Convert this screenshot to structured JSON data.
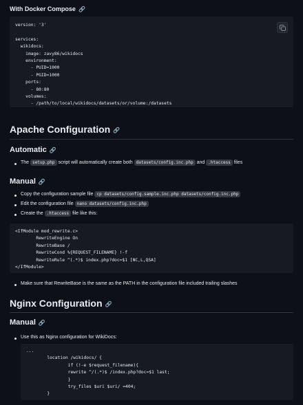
{
  "compose": {
    "heading": "With Docker Compose",
    "code": "version: '3'\n\nservices:\n  wikidocs:\n    image: zavy86/wikidocs\n    environment:\n      - PUID=1000\n      - PGID=1000\n    ports:\n      - 80:80\n    volumes:\n      - /path/to/local/wikidocs/datasets/or/volume:/datasets"
  },
  "apache": {
    "heading": "Apache Configuration",
    "automatic": {
      "heading": "Automatic",
      "line": {
        "t1": "The",
        "c1": "setup.php",
        "t2": "script will automatically create both",
        "c2": "datasets/config.inc.php",
        "t3": "and",
        "c3": ".htaccess",
        "t4": "files"
      }
    },
    "manual": {
      "heading": "Manual",
      "step1": {
        "t1": "Copy the configuration sample file",
        "c1": "cp datasets/config.sample.inc.php datasets/config.inc.php"
      },
      "step2": {
        "t1": "Edit the configuration file",
        "c1": "nano datasets/config.inc.php"
      },
      "step3": {
        "t1": "Create the",
        "c1": ".htaccess",
        "t2": "file like this:"
      },
      "code": "<IfModule mod_rewrite.c>\n        RewriteEngine On\n        RewriteBase /\n        RewriteCond %{REQUEST_FILENAME} !-f\n        RewriteRule ^(.*)$ index.php?doc=$1 [NC,L,QSA]\n</IfModule>",
      "note": "Make sure that RewriteBase is the same as the PATH in the configuration file included trailing slashes"
    }
  },
  "nginx": {
    "heading": "Nginx Configuration",
    "manual": {
      "heading": "Manual",
      "line": "Use this as Nginx configuration for WikiDocs:",
      "code": "...\n        location /wikidocs/ {\n                if (!-e $request_filename){\n                rewrite ^/(.*)$ /index.php?doc=$1 last;\n                }\n                try_files $uri $uri/ =404;\n        }"
    }
  }
}
